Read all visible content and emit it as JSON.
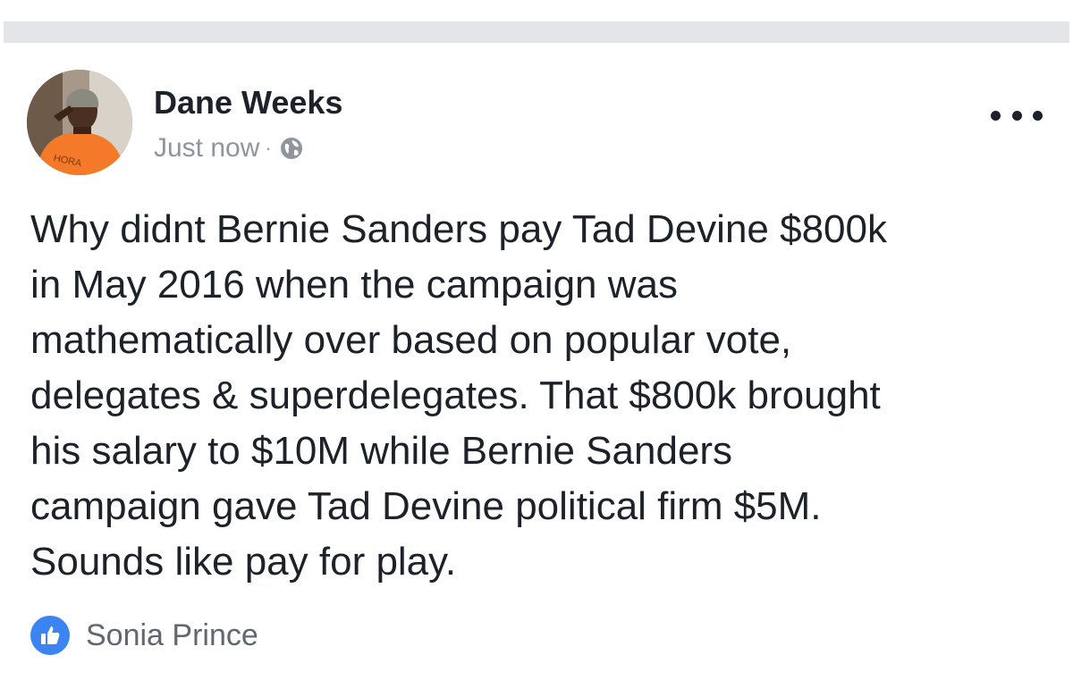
{
  "post": {
    "author": "Dane Weeks",
    "timestamp": "Just now",
    "separator": "·",
    "privacy_icon": "globe-icon",
    "avatar_text": "HORA",
    "more_icon": "more-options-icon",
    "text_lines": [
      "Why didnt Bernie Sanders pay Tad Devine $800k",
      "in May 2016 when the campaign was",
      "mathematically over based on popular vote,",
      "delegates & superdelegates. That $800k brought",
      "his salary to $10M while Bernie Sanders",
      "campaign gave Tad Devine political firm $5M.",
      "Sounds like pay for play."
    ],
    "reactions": {
      "icon": "like-icon",
      "names": "Sonia Prince"
    }
  },
  "colors": {
    "divider": "#e4e5e9",
    "text": "#1d2129",
    "meta": "#90949c",
    "like_blue": "#3b84f1",
    "avatar_shirt": "#f47a2a"
  }
}
